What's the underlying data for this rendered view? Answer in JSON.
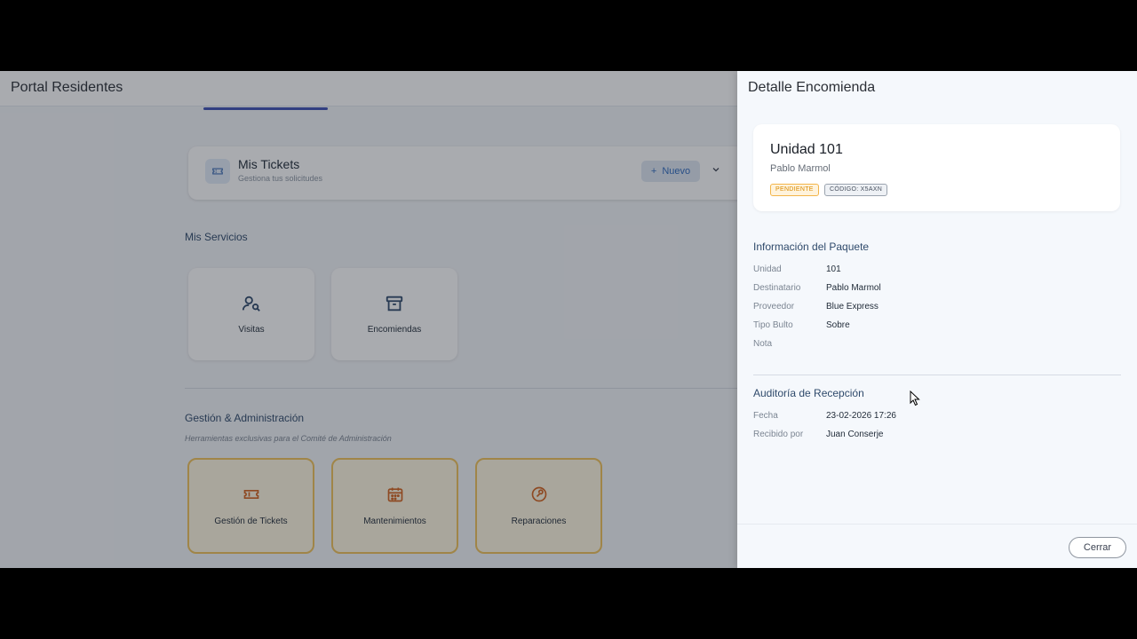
{
  "app": {
    "title": "Portal Residentes"
  },
  "tickets": {
    "title": "Mis Tickets",
    "subtitle": "Gestiona tus solicitudes",
    "new_label": "Nuevo"
  },
  "services": {
    "title": "Mis Servicios",
    "items": [
      {
        "label": "Visitas",
        "icon": "person-search-icon"
      },
      {
        "label": "Encomiendas",
        "icon": "archive-box-icon"
      }
    ]
  },
  "admin": {
    "title": "Gestión & Administración",
    "description": "Herramientas exclusivas para el Comité de Administración",
    "items": [
      {
        "label": "Gestión de Tickets",
        "icon": "ticket-icon"
      },
      {
        "label": "Mantenimientos",
        "icon": "calendar-icon"
      },
      {
        "label": "Reparaciones",
        "icon": "wrench-icon"
      }
    ]
  },
  "drawer": {
    "title": "Detalle Encomienda",
    "unit_title": "Unidad 101",
    "recipient_name": "Pablo Marmol",
    "status_badge": "PENDIENTE",
    "code_badge": "CÓDIGO: X5AXN",
    "package_section": {
      "title": "Información del Paquete",
      "rows": [
        {
          "label": "Unidad",
          "value": "101"
        },
        {
          "label": "Destinatario",
          "value": "Pablo Marmol"
        },
        {
          "label": "Proveedor",
          "value": "Blue Express"
        },
        {
          "label": "Tipo Bulto",
          "value": "Sobre"
        },
        {
          "label": "Nota",
          "value": ""
        }
      ]
    },
    "audit_section": {
      "title": "Auditoría de Recepción",
      "rows": [
        {
          "label": "Fecha",
          "value": "23-02-2026 17:26"
        },
        {
          "label": "Recibido por",
          "value": "Juan Conserje"
        }
      ]
    },
    "close_label": "Cerrar"
  },
  "colors": {
    "accent": "#3f51b5",
    "admin_border": "#f0c25a",
    "admin_bg": "#fff7e1",
    "pending": "#d98a00",
    "section_title": "#2f4a6b"
  }
}
